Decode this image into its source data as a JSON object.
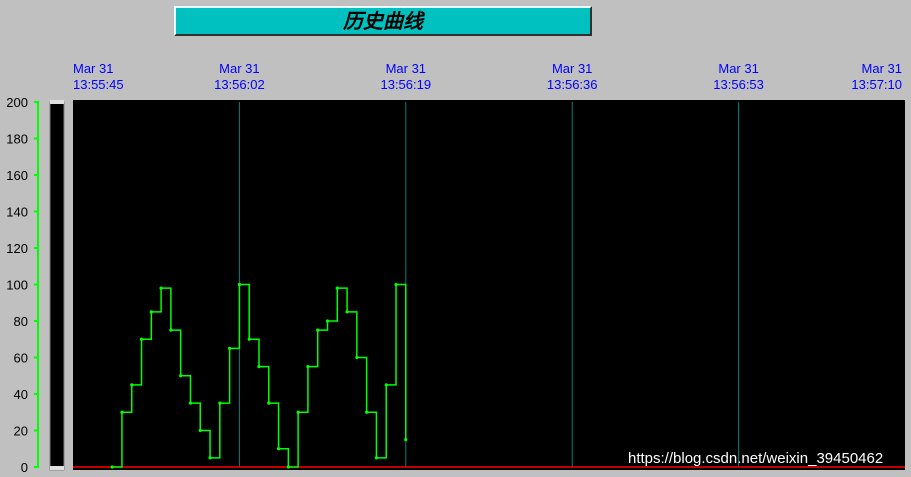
{
  "title": "历史曲线",
  "watermark": "https://blog.csdn.net/weixin_39450462",
  "colors": {
    "background": "#c0c0c0",
    "plot_background": "#000000",
    "series": "#00ff00",
    "grid": "#008080",
    "baseline": "#ff0000",
    "x_tick_text": "#0000ff",
    "title_box": "#00c0c0"
  },
  "chart_data": {
    "type": "line",
    "title": "历史曲线",
    "xlabel": "",
    "ylabel": "",
    "ylim": [
      0,
      200
    ],
    "yticks": [
      0,
      20,
      40,
      60,
      80,
      100,
      120,
      140,
      160,
      180,
      200
    ],
    "x_range_seconds": [
      "13:55:45",
      "13:57:10"
    ],
    "xticks": [
      {
        "date": "Mar 31",
        "time": "13:55:45"
      },
      {
        "date": "Mar 31",
        "time": "13:56:02"
      },
      {
        "date": "Mar 31",
        "time": "13:56:19"
      },
      {
        "date": "Mar 31",
        "time": "13:56:36"
      },
      {
        "date": "Mar 31",
        "time": "13:56:53"
      },
      {
        "date": "Mar 31",
        "time": "13:57:10"
      }
    ],
    "grid": "vertical",
    "series": [
      {
        "x": [
          "13:55:49",
          "13:55:50",
          "13:55:51",
          "13:55:52",
          "13:55:53",
          "13:55:54",
          "13:55:55",
          "13:55:56",
          "13:55:57",
          "13:55:58",
          "13:55:59",
          "13:56:00",
          "13:56:01",
          "13:56:02",
          "13:56:03",
          "13:56:04",
          "13:56:05",
          "13:56:06",
          "13:56:07",
          "13:56:08",
          "13:56:09",
          "13:56:10",
          "13:56:11",
          "13:56:12",
          "13:56:13",
          "13:56:14",
          "13:56:15",
          "13:56:16",
          "13:56:17",
          "13:56:18",
          "13:56:19"
        ],
        "values": [
          0,
          30,
          45,
          70,
          85,
          98,
          75,
          50,
          35,
          20,
          5,
          35,
          65,
          100,
          70,
          55,
          35,
          10,
          0,
          30,
          55,
          75,
          80,
          98,
          85,
          60,
          30,
          5,
          45,
          100,
          15
        ]
      }
    ]
  }
}
